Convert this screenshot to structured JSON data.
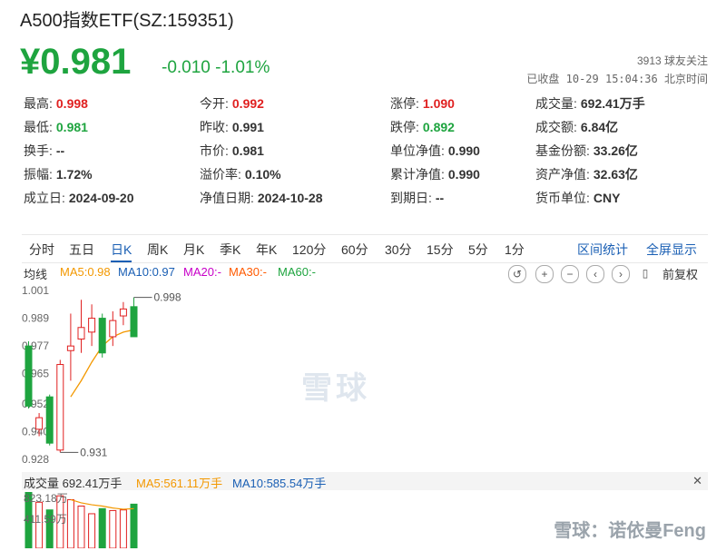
{
  "header": {
    "title": "A500指数ETF(SZ:159351)",
    "price": "¥0.981",
    "change": "-0.010",
    "change_pct": "-1.01%",
    "followers": "3913 球友关注",
    "status": "已收盘 10-29 15:04:36 北京时间"
  },
  "stats": [
    {
      "label": "最高:",
      "value": "0.998",
      "color": "red"
    },
    {
      "label": "今开:",
      "value": "0.992",
      "color": "red"
    },
    {
      "label": "涨停:",
      "value": "1.090",
      "color": "red"
    },
    {
      "label": "成交量:",
      "value": "692.41万手",
      "color": "plain"
    },
    {
      "label": "最低:",
      "value": "0.981",
      "color": "green"
    },
    {
      "label": "昨收:",
      "value": "0.991",
      "color": "plain"
    },
    {
      "label": "跌停:",
      "value": "0.892",
      "color": "green"
    },
    {
      "label": "成交额:",
      "value": "6.84亿",
      "color": "plain"
    },
    {
      "label": "换手:",
      "value": "--",
      "color": "plain"
    },
    {
      "label": "市价:",
      "value": "0.981",
      "color": "plain"
    },
    {
      "label": "单位净值:",
      "value": "0.990",
      "color": "plain"
    },
    {
      "label": "基金份额:",
      "value": "33.26亿",
      "color": "plain"
    },
    {
      "label": "振幅:",
      "value": "1.72%",
      "color": "plain"
    },
    {
      "label": "溢价率:",
      "value": "0.10%",
      "color": "plain"
    },
    {
      "label": "累计净值:",
      "value": "0.990",
      "color": "plain"
    },
    {
      "label": "资产净值:",
      "value": "32.63亿",
      "color": "plain"
    },
    {
      "label": "成立日:",
      "value": "2024-09-20",
      "color": "plain"
    },
    {
      "label": "净值日期:",
      "value": "2024-10-28",
      "color": "plain"
    },
    {
      "label": "到期日:",
      "value": "--",
      "color": "plain"
    },
    {
      "label": "货币单位:",
      "value": "CNY",
      "color": "plain"
    }
  ],
  "tabs": [
    "分时",
    "五日",
    "日K",
    "周K",
    "月K",
    "季K",
    "年K",
    "120分",
    "60分",
    "30分",
    "15分",
    "5分",
    "1分"
  ],
  "active_tab": "日K",
  "tab_links": [
    "区间统计",
    "全屏显示"
  ],
  "ma_bar": {
    "label": "均线",
    "ma5": "MA5:0.98",
    "ma10": "MA10:0.97",
    "ma20": "MA20:-",
    "ma30": "MA30:-",
    "ma60": "MA60:-",
    "restore": "前复权",
    "tools": [
      "undo-icon",
      "zoom-in-icon",
      "zoom-out-icon",
      "prev-icon",
      "next-icon",
      "candle-icon"
    ]
  },
  "volume_bar": {
    "label": "成交量 692.41万手",
    "ma5": "MA5:561.11万手",
    "ma10": "MA10:585.54万手",
    "top_label": "823.18万",
    "mid_label": "411.59万"
  },
  "watermarks": {
    "center": "雪球",
    "corner": "雪球：诺依曼Feng"
  },
  "colors": {
    "up": "#e02020",
    "down": "#1ea43f",
    "link": "#1a5fb4",
    "ma5": "#f39800",
    "ma10": "#1a5fb4",
    "ma20": "#c800c8",
    "ma30": "#ff5a00",
    "ma60": "#1ea43f"
  },
  "chart_data": {
    "type": "candlestick",
    "y_ticks": [
      "1.001",
      "0.989",
      "0.977",
      "0.965",
      "0.952",
      "0.940",
      "0.928"
    ],
    "ylim": [
      0.928,
      1.001
    ],
    "high_label": "0.998",
    "low_label": "0.931",
    "candles": [
      {
        "open": 0.977,
        "close": 0.951,
        "high": 0.979,
        "low": 0.95
      },
      {
        "open": 0.941,
        "close": 0.946,
        "high": 0.948,
        "low": 0.938
      },
      {
        "open": 0.955,
        "close": 0.935,
        "high": 0.956,
        "low": 0.934
      },
      {
        "open": 0.932,
        "close": 0.969,
        "high": 0.971,
        "low": 0.931
      },
      {
        "open": 0.975,
        "close": 0.977,
        "high": 0.991,
        "low": 0.962
      },
      {
        "open": 0.98,
        "close": 0.985,
        "high": 0.997,
        "low": 0.974
      },
      {
        "open": 0.983,
        "close": 0.989,
        "high": 0.995,
        "low": 0.977
      },
      {
        "open": 0.989,
        "close": 0.974,
        "high": 0.991,
        "low": 0.972
      },
      {
        "open": 0.981,
        "close": 0.988,
        "high": 0.992,
        "low": 0.977
      },
      {
        "open": 0.99,
        "close": 0.993,
        "high": 0.996,
        "low": 0.986
      },
      {
        "open": 0.994,
        "close": 0.981,
        "high": 0.998,
        "low": 0.981
      }
    ],
    "ma5": [
      null,
      null,
      null,
      null,
      0.955,
      0.962,
      0.97,
      0.977,
      0.981,
      0.983,
      0.984
    ],
    "volume": [
      9.0,
      7.2,
      6.0,
      8.2,
      7.6,
      6.6,
      5.4,
      6.2,
      5.9,
      6.0,
      6.9
    ],
    "volume_ylim": [
      0,
      8.2318
    ],
    "volume_ma": [
      null,
      null,
      null,
      null,
      7.6,
      7.1,
      6.8,
      6.6,
      6.3,
      6.1,
      6.2
    ]
  }
}
